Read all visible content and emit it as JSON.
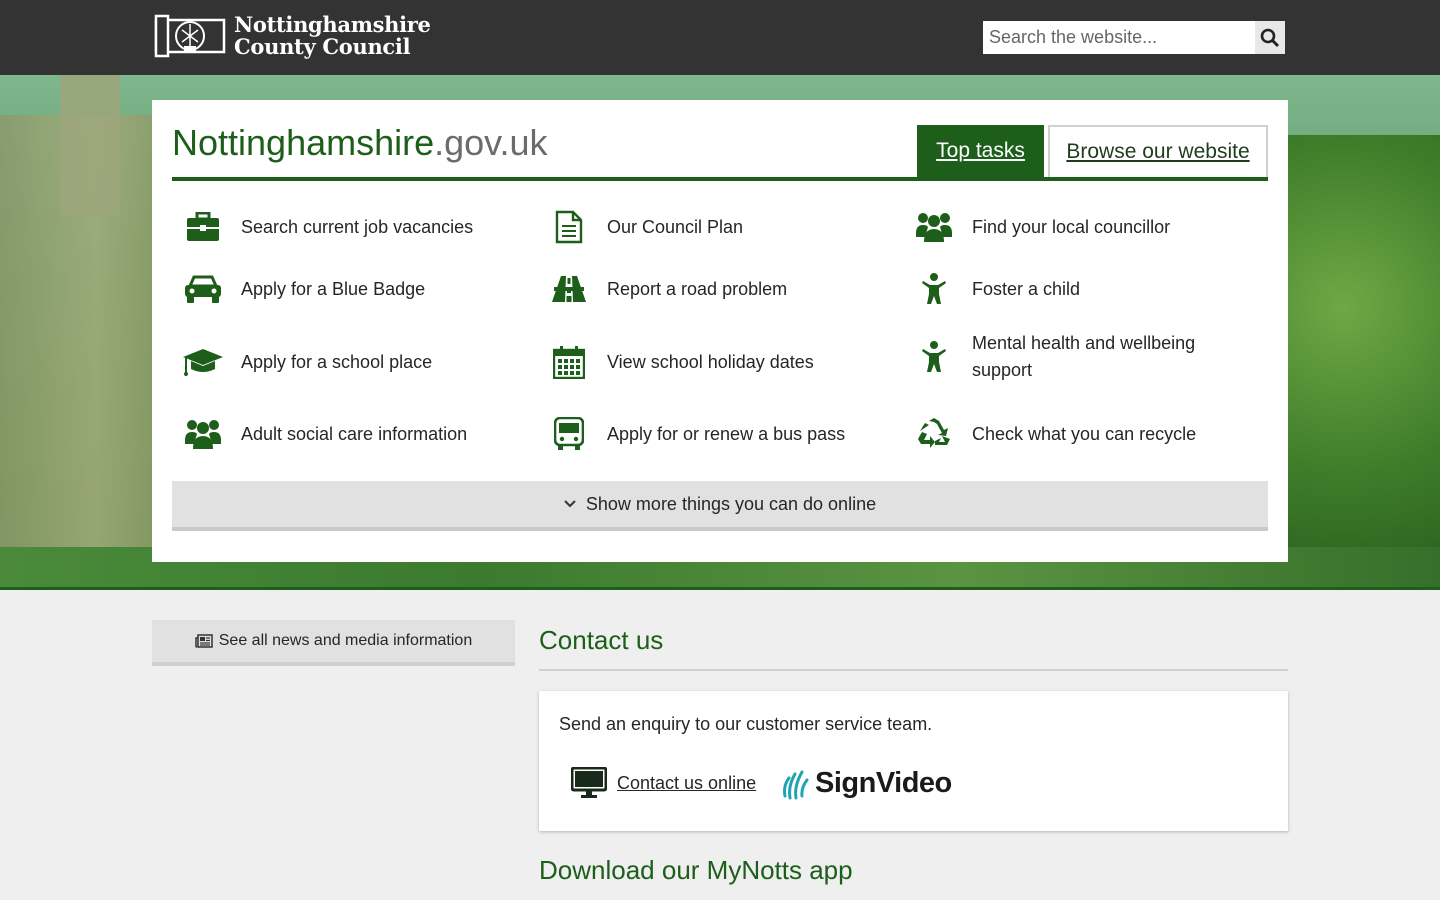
{
  "header": {
    "logo_line1": "Nottinghamshire",
    "logo_line2": "County Council",
    "search_placeholder": "Search the website..."
  },
  "panel": {
    "title_main": "Nottinghamshire",
    "title_suffix": ".gov.uk",
    "tabs": [
      {
        "label": "Top tasks",
        "active": true
      },
      {
        "label": "Browse our website",
        "active": false
      }
    ],
    "tasks": [
      {
        "label": "Search current job vacancies",
        "icon": "briefcase-icon"
      },
      {
        "label": "Our Council Plan",
        "icon": "document-icon"
      },
      {
        "label": "Find your local councillor",
        "icon": "people-icon"
      },
      {
        "label": "Apply for a Blue Badge",
        "icon": "car-icon"
      },
      {
        "label": "Report a road problem",
        "icon": "road-icon"
      },
      {
        "label": "Foster a child",
        "icon": "child-icon"
      },
      {
        "label": "Apply for a school place",
        "icon": "graduation-cap-icon"
      },
      {
        "label": "View school holiday dates",
        "icon": "calendar-icon"
      },
      {
        "label": "Mental health and wellbeing support",
        "icon": "child-icon"
      },
      {
        "label": "Adult social care information",
        "icon": "people-icon"
      },
      {
        "label": "Apply for or renew a bus pass",
        "icon": "bus-icon"
      },
      {
        "label": "Check what you can recycle",
        "icon": "recycle-icon"
      }
    ],
    "show_more": "Show more things you can do online"
  },
  "news": {
    "label": "See all news and media information"
  },
  "contact": {
    "heading": "Contact us",
    "description": "Send an enquiry to our customer service team.",
    "link_label": "Contact us online",
    "signvideo_label": "SignVideo"
  },
  "app": {
    "heading": "Download our MyNotts app"
  },
  "colors": {
    "brand_green": "#1d5e1a",
    "header_bg": "#333333",
    "page_bg": "#efefef"
  }
}
